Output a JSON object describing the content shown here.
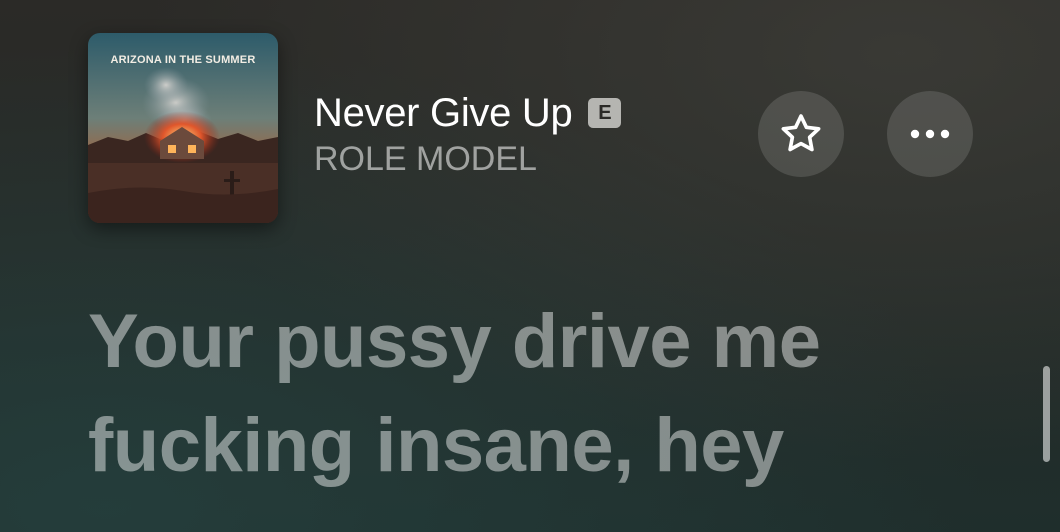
{
  "album": {
    "cover_text": "ARIZONA IN THE SUMMER",
    "icon": "album-artwork"
  },
  "track": {
    "title": "Never Give Up",
    "explicit_badge": "E",
    "artist": "ROLE MODEL"
  },
  "actions": {
    "favorite_icon": "star-outline-icon",
    "more_icon": "ellipsis-icon"
  },
  "lyrics": {
    "lines": [
      "Your pussy drive me",
      "fucking insane, hey"
    ]
  },
  "colors": {
    "background": "#262a27",
    "lyric_text": "rgba(255,255,255,0.45)",
    "badge_bg": "#b5b5b1",
    "button_bg": "rgba(255,255,255,0.13)"
  }
}
